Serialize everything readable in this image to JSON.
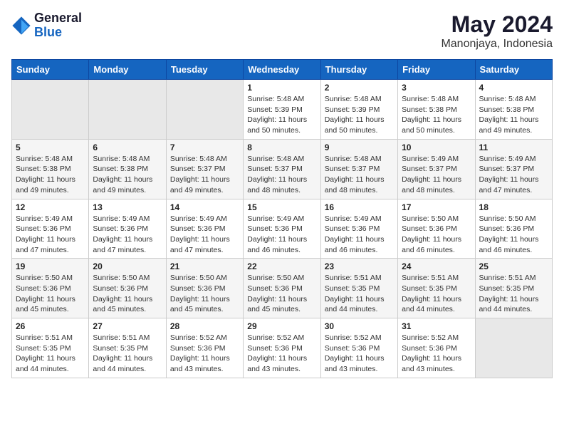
{
  "header": {
    "logo": {
      "general": "General",
      "blue": "Blue"
    },
    "title": "May 2024",
    "subtitle": "Manonjaya, Indonesia"
  },
  "weekdays": [
    "Sunday",
    "Monday",
    "Tuesday",
    "Wednesday",
    "Thursday",
    "Friday",
    "Saturday"
  ],
  "weeks": [
    [
      {
        "day": "",
        "info": ""
      },
      {
        "day": "",
        "info": ""
      },
      {
        "day": "",
        "info": ""
      },
      {
        "day": "1",
        "info": "Sunrise: 5:48 AM\nSunset: 5:39 PM\nDaylight: 11 hours\nand 50 minutes."
      },
      {
        "day": "2",
        "info": "Sunrise: 5:48 AM\nSunset: 5:39 PM\nDaylight: 11 hours\nand 50 minutes."
      },
      {
        "day": "3",
        "info": "Sunrise: 5:48 AM\nSunset: 5:38 PM\nDaylight: 11 hours\nand 50 minutes."
      },
      {
        "day": "4",
        "info": "Sunrise: 5:48 AM\nSunset: 5:38 PM\nDaylight: 11 hours\nand 49 minutes."
      }
    ],
    [
      {
        "day": "5",
        "info": "Sunrise: 5:48 AM\nSunset: 5:38 PM\nDaylight: 11 hours\nand 49 minutes."
      },
      {
        "day": "6",
        "info": "Sunrise: 5:48 AM\nSunset: 5:38 PM\nDaylight: 11 hours\nand 49 minutes."
      },
      {
        "day": "7",
        "info": "Sunrise: 5:48 AM\nSunset: 5:37 PM\nDaylight: 11 hours\nand 49 minutes."
      },
      {
        "day": "8",
        "info": "Sunrise: 5:48 AM\nSunset: 5:37 PM\nDaylight: 11 hours\nand 48 minutes."
      },
      {
        "day": "9",
        "info": "Sunrise: 5:48 AM\nSunset: 5:37 PM\nDaylight: 11 hours\nand 48 minutes."
      },
      {
        "day": "10",
        "info": "Sunrise: 5:49 AM\nSunset: 5:37 PM\nDaylight: 11 hours\nand 48 minutes."
      },
      {
        "day": "11",
        "info": "Sunrise: 5:49 AM\nSunset: 5:37 PM\nDaylight: 11 hours\nand 47 minutes."
      }
    ],
    [
      {
        "day": "12",
        "info": "Sunrise: 5:49 AM\nSunset: 5:36 PM\nDaylight: 11 hours\nand 47 minutes."
      },
      {
        "day": "13",
        "info": "Sunrise: 5:49 AM\nSunset: 5:36 PM\nDaylight: 11 hours\nand 47 minutes."
      },
      {
        "day": "14",
        "info": "Sunrise: 5:49 AM\nSunset: 5:36 PM\nDaylight: 11 hours\nand 47 minutes."
      },
      {
        "day": "15",
        "info": "Sunrise: 5:49 AM\nSunset: 5:36 PM\nDaylight: 11 hours\nand 46 minutes."
      },
      {
        "day": "16",
        "info": "Sunrise: 5:49 AM\nSunset: 5:36 PM\nDaylight: 11 hours\nand 46 minutes."
      },
      {
        "day": "17",
        "info": "Sunrise: 5:50 AM\nSunset: 5:36 PM\nDaylight: 11 hours\nand 46 minutes."
      },
      {
        "day": "18",
        "info": "Sunrise: 5:50 AM\nSunset: 5:36 PM\nDaylight: 11 hours\nand 46 minutes."
      }
    ],
    [
      {
        "day": "19",
        "info": "Sunrise: 5:50 AM\nSunset: 5:36 PM\nDaylight: 11 hours\nand 45 minutes."
      },
      {
        "day": "20",
        "info": "Sunrise: 5:50 AM\nSunset: 5:36 PM\nDaylight: 11 hours\nand 45 minutes."
      },
      {
        "day": "21",
        "info": "Sunrise: 5:50 AM\nSunset: 5:36 PM\nDaylight: 11 hours\nand 45 minutes."
      },
      {
        "day": "22",
        "info": "Sunrise: 5:50 AM\nSunset: 5:36 PM\nDaylight: 11 hours\nand 45 minutes."
      },
      {
        "day": "23",
        "info": "Sunrise: 5:51 AM\nSunset: 5:35 PM\nDaylight: 11 hours\nand 44 minutes."
      },
      {
        "day": "24",
        "info": "Sunrise: 5:51 AM\nSunset: 5:35 PM\nDaylight: 11 hours\nand 44 minutes."
      },
      {
        "day": "25",
        "info": "Sunrise: 5:51 AM\nSunset: 5:35 PM\nDaylight: 11 hours\nand 44 minutes."
      }
    ],
    [
      {
        "day": "26",
        "info": "Sunrise: 5:51 AM\nSunset: 5:35 PM\nDaylight: 11 hours\nand 44 minutes."
      },
      {
        "day": "27",
        "info": "Sunrise: 5:51 AM\nSunset: 5:35 PM\nDaylight: 11 hours\nand 44 minutes."
      },
      {
        "day": "28",
        "info": "Sunrise: 5:52 AM\nSunset: 5:36 PM\nDaylight: 11 hours\nand 43 minutes."
      },
      {
        "day": "29",
        "info": "Sunrise: 5:52 AM\nSunset: 5:36 PM\nDaylight: 11 hours\nand 43 minutes."
      },
      {
        "day": "30",
        "info": "Sunrise: 5:52 AM\nSunset: 5:36 PM\nDaylight: 11 hours\nand 43 minutes."
      },
      {
        "day": "31",
        "info": "Sunrise: 5:52 AM\nSunset: 5:36 PM\nDaylight: 11 hours\nand 43 minutes."
      },
      {
        "day": "",
        "info": ""
      }
    ]
  ]
}
